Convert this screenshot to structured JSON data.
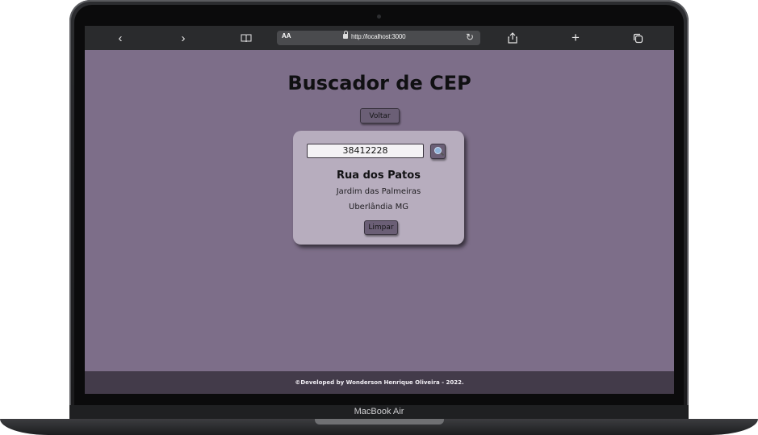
{
  "device": {
    "brand_label": "MacBook Air"
  },
  "browser": {
    "back_glyph": "‹",
    "forward_glyph": "›",
    "bookmarks_glyph": "📖",
    "reader_label": "AA",
    "url": "http://localhost:3000",
    "reload_glyph": "↻",
    "share_glyph": "⇪",
    "new_tab_glyph": "+",
    "tabs_glyph": "⧉"
  },
  "page": {
    "title": "Buscador de CEP",
    "back_button": "Voltar",
    "cep_value": "38412228",
    "result": {
      "street": "Rua dos Patos",
      "neighborhood": "Jardim das Palmeiras",
      "city_state": "Uberlândia MG"
    },
    "clear_button": "Limpar",
    "footer": "©Developed by Wonderson Henrique Oliveira - 2022."
  },
  "colors": {
    "page_bg": "#7d6e89",
    "card_bg": "#b7adbe",
    "button_bg": "#6b5f76",
    "footer_bg": "#433b4a"
  }
}
